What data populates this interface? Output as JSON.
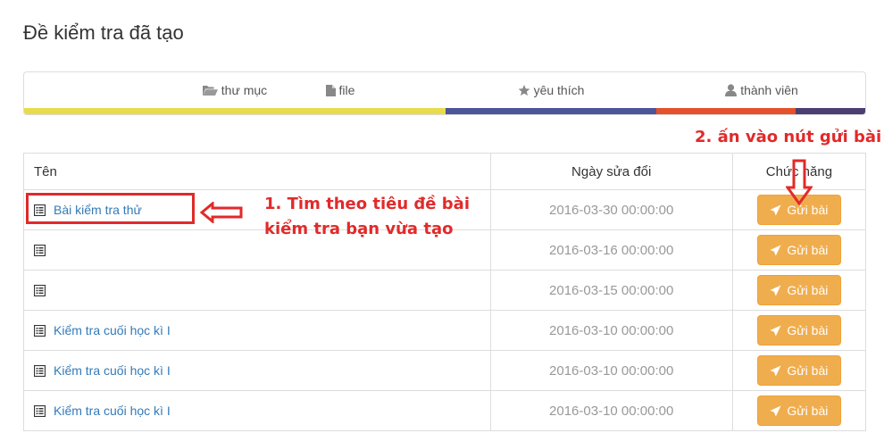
{
  "page": {
    "title": "Đề kiểm tra đã tạo"
  },
  "tabs": [
    {
      "label": "thư mục",
      "icon": "folder-open-icon",
      "color": "#e9dc4c"
    },
    {
      "label": "file",
      "icon": "file-icon",
      "color": "#e9dc4c"
    },
    {
      "label": "yêu thích",
      "icon": "star-icon",
      "color": "#4b5597"
    },
    {
      "label": "thành viên",
      "icon": "user-icon",
      "color": "#e4512b"
    }
  ],
  "table": {
    "headers": {
      "name": "Tên",
      "modified": "Ngày sửa đổi",
      "action": "Chức năng"
    },
    "rows": [
      {
        "name": "Bài kiểm tra thử",
        "date": "2016-03-30 00:00:00",
        "button": "Gửi bài"
      },
      {
        "name": "",
        "date": "2016-03-16 00:00:00",
        "button": "Gửi bài"
      },
      {
        "name": "",
        "date": "2016-03-15 00:00:00",
        "button": "Gửi bài"
      },
      {
        "name": "Kiểm tra cuối học kì I",
        "date": "2016-03-10 00:00:00",
        "button": "Gửi bài"
      },
      {
        "name": "Kiểm tra cuối học kì I",
        "date": "2016-03-10 00:00:00",
        "button": "Gửi bài"
      },
      {
        "name": "Kiểm tra cuối học kì I",
        "date": "2016-03-10 00:00:00",
        "button": "Gửi bài"
      }
    ]
  },
  "annotations": {
    "step1": "1. Tìm theo tiêu đề bài kiểm tra bạn vừa tạo",
    "step2": "2. ấn vào nút gửi bài",
    "color": "#e12a2a"
  },
  "colors": {
    "button": "#f0ad4e",
    "link": "#337ab7",
    "bar_dark": "#4b3f72"
  }
}
